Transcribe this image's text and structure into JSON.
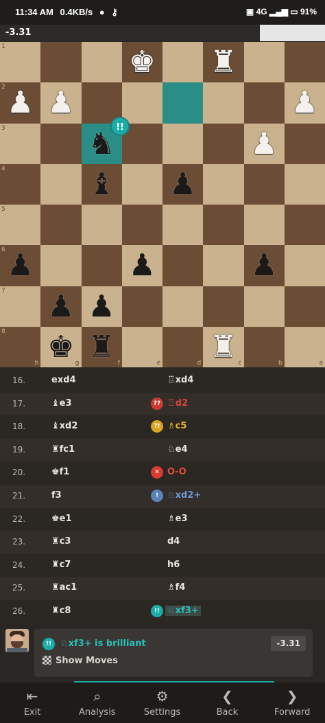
{
  "status_bar": {
    "time": "11:34 AM",
    "speed": "0.4KB/s",
    "signal": "4G",
    "battery": "91"
  },
  "eval_bar": {
    "score": "-3.31",
    "white_fraction": 0.2
  },
  "board": {
    "rank_labels": [
      "1",
      "2",
      "3",
      "4",
      "5",
      "6",
      "7",
      "8"
    ],
    "file_labels": [
      "h",
      "g",
      "f",
      "e",
      "d",
      "c",
      "b",
      "a"
    ],
    "highlight_squares": [
      "e2",
      "f3"
    ],
    "brilliant_badge": "!!",
    "pieces": [
      {
        "row": 0,
        "col": 3,
        "glyph": "♚",
        "color": "white",
        "name": "white-king"
      },
      {
        "row": 0,
        "col": 5,
        "glyph": "♜",
        "color": "white",
        "name": "white-rook"
      },
      {
        "row": 1,
        "col": 0,
        "glyph": "♟",
        "color": "white",
        "name": "white-pawn"
      },
      {
        "row": 1,
        "col": 1,
        "glyph": "♟",
        "color": "white",
        "name": "white-pawn"
      },
      {
        "row": 1,
        "col": 7,
        "glyph": "♟",
        "color": "white",
        "name": "white-pawn"
      },
      {
        "row": 2,
        "col": 2,
        "glyph": "♞",
        "color": "black",
        "name": "black-knight"
      },
      {
        "row": 2,
        "col": 6,
        "glyph": "♟",
        "color": "white",
        "name": "white-pawn"
      },
      {
        "row": 3,
        "col": 2,
        "glyph": "♝",
        "color": "black",
        "name": "black-bishop"
      },
      {
        "row": 3,
        "col": 4,
        "glyph": "♟",
        "color": "black",
        "name": "black-pawn"
      },
      {
        "row": 5,
        "col": 0,
        "glyph": "♟",
        "color": "black",
        "name": "black-pawn"
      },
      {
        "row": 5,
        "col": 3,
        "glyph": "♟",
        "color": "black",
        "name": "black-pawn"
      },
      {
        "row": 5,
        "col": 6,
        "glyph": "♟",
        "color": "black",
        "name": "black-pawn"
      },
      {
        "row": 6,
        "col": 1,
        "glyph": "♟",
        "color": "black",
        "name": "black-pawn"
      },
      {
        "row": 6,
        "col": 2,
        "glyph": "♟",
        "color": "black",
        "name": "black-pawn"
      },
      {
        "row": 7,
        "col": 1,
        "glyph": "♚",
        "color": "black",
        "name": "black-king"
      },
      {
        "row": 7,
        "col": 2,
        "glyph": "♜",
        "color": "black",
        "name": "black-rook"
      },
      {
        "row": 7,
        "col": 5,
        "glyph": "♜",
        "color": "white",
        "name": "white-rook"
      }
    ]
  },
  "moves": [
    {
      "num": "16.",
      "white": "exd4",
      "black": "♖xd4",
      "badge": "",
      "badge_color": "",
      "black_color": "#e8e6e3"
    },
    {
      "num": "17.",
      "white": "♝e3",
      "black": "♖d2",
      "badge": "??",
      "badge_color": "#c93a2f",
      "black_color": "#d9473b"
    },
    {
      "num": "18.",
      "white": "♝xd2",
      "black": "♗c5",
      "badge": "?!",
      "badge_color": "#d9a421",
      "black_color": "#e6b530"
    },
    {
      "num": "19.",
      "white": "♜fc1",
      "black": "♘e4",
      "badge": "",
      "badge_color": "",
      "black_color": "#e8e6e3"
    },
    {
      "num": "20.",
      "white": "♚f1",
      "black": "O-O",
      "badge": "✕",
      "badge_color": "#d63c30",
      "black_color": "#e04a3c"
    },
    {
      "num": "21.",
      "white": "f3",
      "black": "♘xd2+",
      "badge": "!",
      "badge_color": "#5a84b8",
      "black_color": "#6f9bd0"
    },
    {
      "num": "22.",
      "white": "♚e1",
      "black": "♗e3",
      "badge": "",
      "badge_color": "",
      "black_color": "#e8e6e3"
    },
    {
      "num": "23.",
      "white": "♜c3",
      "black": "d4",
      "badge": "",
      "badge_color": "",
      "black_color": "#e8e6e3"
    },
    {
      "num": "24.",
      "white": "♜c7",
      "black": "h6",
      "badge": "",
      "badge_color": "",
      "black_color": "#e8e6e3"
    },
    {
      "num": "25.",
      "white": "♜ac1",
      "black": "♗f4",
      "badge": "",
      "badge_color": "",
      "black_color": "#e8e6e3"
    },
    {
      "num": "26.",
      "white": "♜c8",
      "black": "♘xf3+",
      "badge": "!!",
      "badge_color": "#1bada6",
      "black_color": "#26c2ba"
    }
  ],
  "feedback": {
    "icon": "!!",
    "text": "♘xf3+ is brilliant",
    "eval": "-3.31",
    "show_moves": "Show Moves"
  },
  "navbar": {
    "items": [
      {
        "label": "Exit",
        "icon": "exit-icon",
        "glyph": "⇤"
      },
      {
        "label": "Analysis",
        "icon": "analysis-icon",
        "glyph": "⌕"
      },
      {
        "label": "Settings",
        "icon": "gear-icon",
        "glyph": "⚙"
      },
      {
        "label": "Back",
        "icon": "chevron-left-icon",
        "glyph": "❮"
      },
      {
        "label": "Forward",
        "icon": "chevron-right-icon",
        "glyph": "❯"
      }
    ]
  }
}
